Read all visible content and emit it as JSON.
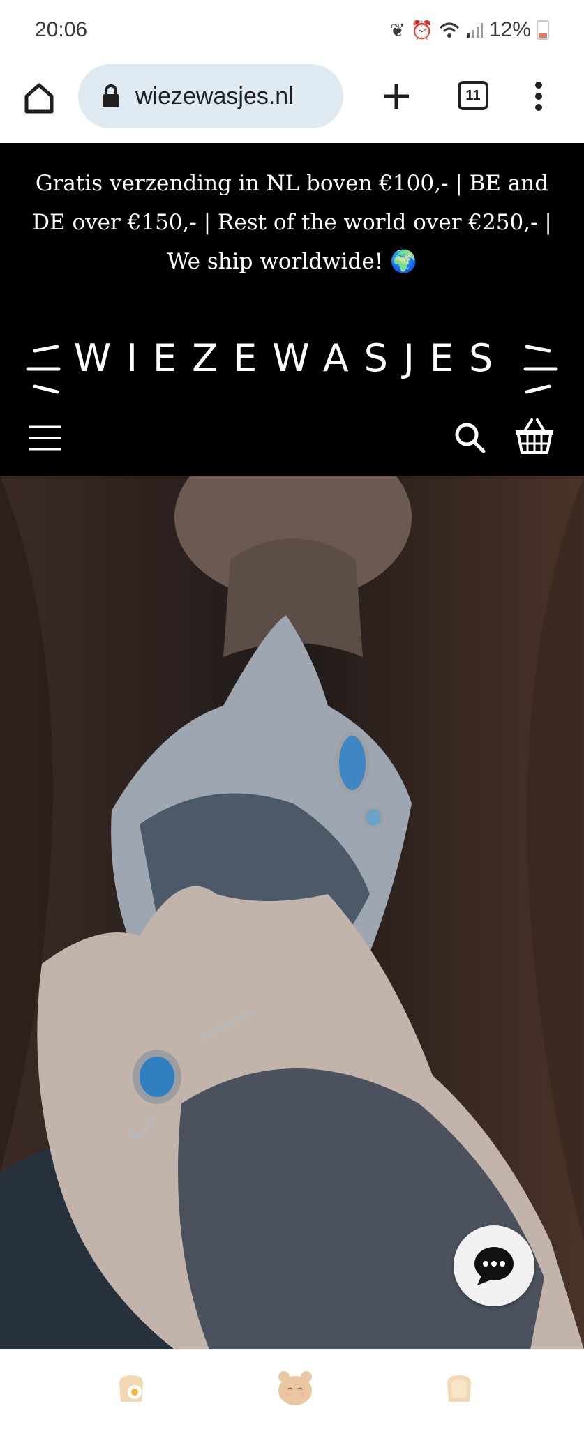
{
  "status_bar": {
    "time": "20:06",
    "battery": "12%"
  },
  "browser": {
    "url": "wiezewasjes.nl",
    "tab_count": "11"
  },
  "announcement": {
    "text": "Gratis verzending in NL boven €100,- | BE and DE over €150,- | Rest of the world over €250,- | We ship worldwide! 🌍"
  },
  "header": {
    "logo_text": "WIEZEWASJES"
  },
  "icons": {
    "home": "home-icon",
    "lock": "lock-icon",
    "new_tab": "plus-icon",
    "tabs": "tabs-icon",
    "menu": "more-vert-icon",
    "hamburger": "hamburger-menu-icon",
    "search": "search-icon",
    "cart": "basket-icon",
    "chat": "chat-bubble-icon"
  },
  "colors": {
    "header_bg": "#000000",
    "url_pill": "#dfe9f1",
    "battery_low": "#e07b66"
  }
}
